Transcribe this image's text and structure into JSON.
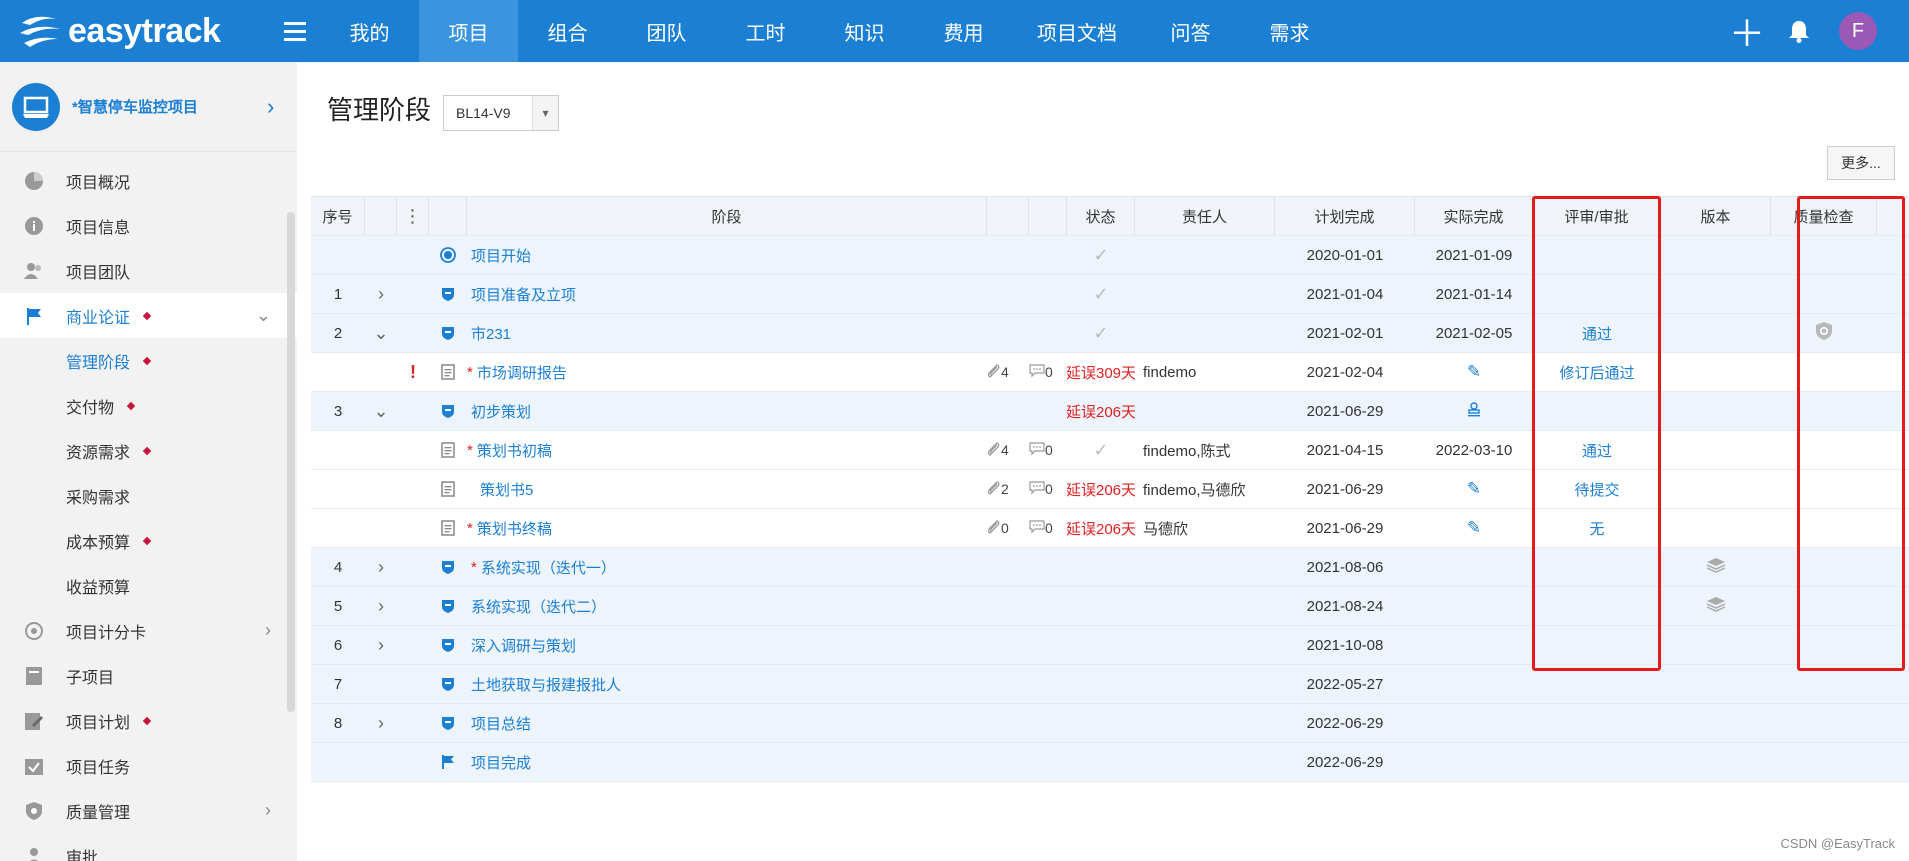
{
  "app": {
    "name": "easytrack"
  },
  "nav": [
    "我的",
    "项目",
    "组合",
    "团队",
    "工时",
    "知识",
    "费用",
    "项目文档",
    "问答",
    "需求"
  ],
  "nav_active": 1,
  "user": {
    "initial": "F",
    "avatar_color": "#9b59b6"
  },
  "project": {
    "name": "*智慧停车监控项目"
  },
  "sidebar": [
    {
      "label": "项目概况",
      "icon": "pie-chart-icon",
      "type": "top"
    },
    {
      "label": "项目信息",
      "icon": "info-icon",
      "type": "top"
    },
    {
      "label": "项目团队",
      "icon": "team-icon",
      "type": "top"
    },
    {
      "label": "商业论证",
      "icon": "flag-icon",
      "type": "active-parent",
      "dot": true,
      "chevron": "⌄"
    },
    {
      "label": "管理阶段",
      "type": "sub current",
      "dot": true
    },
    {
      "label": "交付物",
      "type": "sub",
      "dot": true
    },
    {
      "label": "资源需求",
      "type": "sub",
      "dot": true
    },
    {
      "label": "采购需求",
      "type": "sub"
    },
    {
      "label": "成本预算",
      "type": "sub",
      "dot": true
    },
    {
      "label": "收益预算",
      "type": "sub"
    },
    {
      "label": "项目计分卡",
      "icon": "scorecard-icon",
      "type": "top",
      "chevron": "›"
    },
    {
      "label": "子项目",
      "icon": "subproject-icon",
      "type": "top"
    },
    {
      "label": "项目计划",
      "icon": "plan-icon",
      "type": "top",
      "dot": true
    },
    {
      "label": "项目任务",
      "icon": "task-icon",
      "type": "top"
    },
    {
      "label": "质量管理",
      "icon": "shield-icon",
      "type": "top",
      "chevron": "›"
    },
    {
      "label": "审批",
      "icon": "user-icon",
      "type": "top"
    }
  ],
  "page": {
    "title": "管理阶段",
    "version": "BL14-V9",
    "more_label": "更多..."
  },
  "table": {
    "headers": {
      "no": "序号",
      "stage": "阶段",
      "status": "状态",
      "owner": "责任人",
      "plan": "计划完成",
      "actual": "实际完成",
      "review": "评审/审批",
      "version": "版本",
      "quality": "质量检查"
    },
    "rows": [
      {
        "kind": "stage",
        "no": "",
        "exp": "",
        "icon": "milestone-start-icon",
        "req": false,
        "name": "项目开始",
        "att": "",
        "cmt": "",
        "status": "✓",
        "owner": "",
        "plan": "2020-01-01",
        "actual": "2021-01-09",
        "review": "",
        "ver": "",
        "qc": ""
      },
      {
        "kind": "stage",
        "no": "1",
        "exp": "›",
        "icon": "stage-shield-icon",
        "req": false,
        "name": "项目准备及立项",
        "att": "",
        "cmt": "",
        "status": "✓",
        "owner": "",
        "plan": "2021-01-04",
        "actual": "2021-01-14",
        "review": "",
        "ver": "",
        "qc": ""
      },
      {
        "kind": "stage",
        "no": "2",
        "exp": "⌄",
        "icon": "stage-shield-icon",
        "req": false,
        "name": "市231",
        "att": "",
        "cmt": "",
        "status": "✓",
        "owner": "",
        "plan": "2021-02-01",
        "actual": "2021-02-05",
        "review": "通过",
        "ver": "",
        "qc": "shield"
      },
      {
        "kind": "doc",
        "no": "",
        "exp": "",
        "mark": "!",
        "icon": "document-icon",
        "req": true,
        "name": "市场调研报告",
        "att": "4",
        "cmt": "0",
        "status": "延误309天",
        "owner": "findemo",
        "plan": "2021-02-04",
        "actual": "✎",
        "review": "修订后通过",
        "ver": "",
        "qc": ""
      },
      {
        "kind": "stage",
        "no": "3",
        "exp": "⌄",
        "icon": "stage-shield-icon",
        "req": false,
        "name": "初步策划",
        "att": "",
        "cmt": "",
        "status": "延误206天",
        "owner": "",
        "plan": "2021-06-29",
        "actual": "stamp",
        "review": "",
        "ver": "",
        "qc": ""
      },
      {
        "kind": "doc",
        "no": "",
        "exp": "",
        "icon": "document-icon",
        "req": true,
        "name": "策划书初稿",
        "att": "4",
        "cmt": "0",
        "status": "✓",
        "owner": "findemo,陈式",
        "plan": "2021-04-15",
        "actual": "2022-03-10",
        "review": "通过",
        "ver": "",
        "qc": ""
      },
      {
        "kind": "doc",
        "no": "",
        "exp": "",
        "icon": "document-icon",
        "req": false,
        "name": "策划书5",
        "att": "2",
        "cmt": "0",
        "status": "延误206天",
        "owner": "findemo,马德欣",
        "plan": "2021-06-29",
        "actual": "✎",
        "review": "待提交",
        "ver": "",
        "qc": ""
      },
      {
        "kind": "doc",
        "no": "",
        "exp": "",
        "icon": "document-icon",
        "req": true,
        "name": "策划书终稿",
        "att": "0",
        "cmt": "0",
        "status": "延误206天",
        "owner": "马德欣",
        "plan": "2021-06-29",
        "actual": "✎",
        "review": "无",
        "ver": "",
        "qc": ""
      },
      {
        "kind": "stage",
        "no": "4",
        "exp": "›",
        "icon": "stage-shield-icon",
        "req": true,
        "name": "系统实现（迭代一）",
        "att": "",
        "cmt": "",
        "status": "",
        "owner": "",
        "plan": "2021-08-06",
        "actual": "",
        "review": "",
        "ver": "layers",
        "qc": ""
      },
      {
        "kind": "stage",
        "no": "5",
        "exp": "›",
        "icon": "stage-shield-icon",
        "req": false,
        "name": "系统实现（迭代二）",
        "att": "",
        "cmt": "",
        "status": "",
        "owner": "",
        "plan": "2021-08-24",
        "actual": "",
        "review": "",
        "ver": "layers",
        "qc": ""
      },
      {
        "kind": "stage",
        "no": "6",
        "exp": "›",
        "icon": "stage-shield-icon",
        "req": false,
        "name": "深入调研与策划",
        "att": "",
        "cmt": "",
        "status": "",
        "owner": "",
        "plan": "2021-10-08",
        "actual": "",
        "review": "",
        "ver": "",
        "qc": ""
      },
      {
        "kind": "stage",
        "no": "7",
        "exp": "",
        "icon": "stage-shield-icon",
        "req": false,
        "name": "土地获取与报建报批人",
        "att": "",
        "cmt": "",
        "status": "",
        "owner": "",
        "plan": "2022-05-27",
        "actual": "",
        "review": "",
        "ver": "",
        "qc": ""
      },
      {
        "kind": "stage",
        "no": "8",
        "exp": "›",
        "icon": "stage-shield-icon",
        "req": false,
        "name": "项目总结",
        "att": "",
        "cmt": "",
        "status": "",
        "owner": "",
        "plan": "2022-06-29",
        "actual": "",
        "review": "",
        "ver": "",
        "qc": ""
      },
      {
        "kind": "stage",
        "no": "",
        "exp": "",
        "icon": "milestone-flag-icon",
        "req": false,
        "name": "项目完成",
        "att": "",
        "cmt": "",
        "status": "",
        "owner": "",
        "plan": "2022-06-29",
        "actual": "",
        "review": "",
        "ver": "",
        "qc": ""
      }
    ]
  },
  "watermark": "CSDN @EasyTrack",
  "colors": {
    "brand": "#1b7fd4",
    "nav_active": "#3a94e0",
    "delay": "#e02020",
    "highlight_box": "#e41b1b"
  }
}
